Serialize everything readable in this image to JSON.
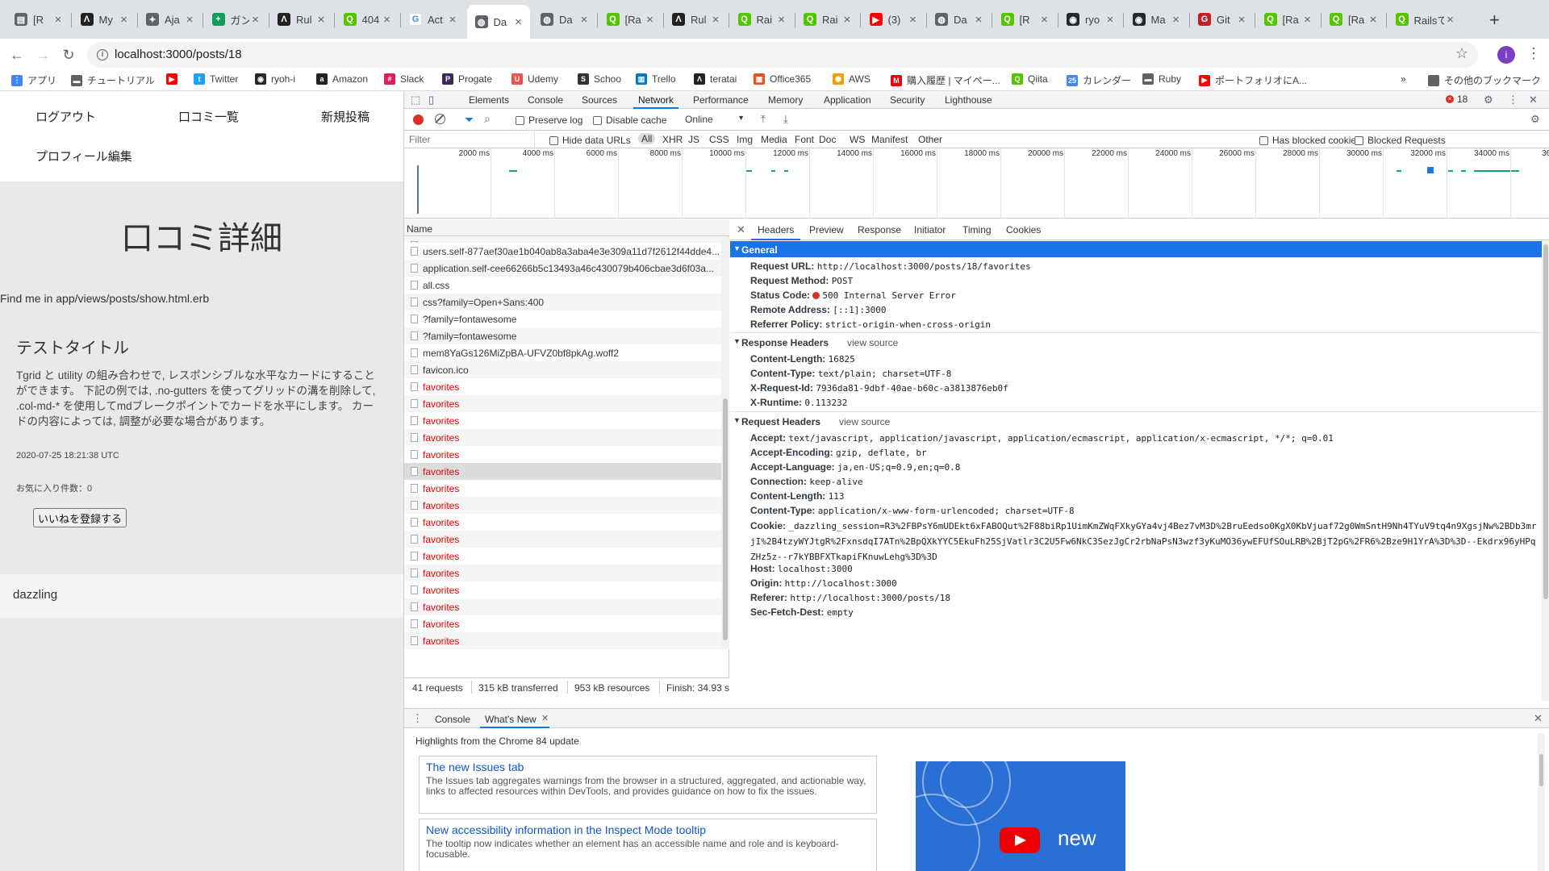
{
  "tabs": [
    {
      "title": "[R",
      "icon": "doc-icon",
      "color": "#5f6368",
      "glyph": "▤"
    },
    {
      "title": "My",
      "icon": "atcoder-icon",
      "color": "#222222",
      "glyph": "Λ"
    },
    {
      "title": "Aja",
      "icon": "puzzle-icon",
      "color": "#5f6368",
      "glyph": "✦"
    },
    {
      "title": "ガン",
      "icon": "sheets-icon",
      "color": "#0f9d58",
      "glyph": "+"
    },
    {
      "title": "Rul",
      "icon": "atcoder-icon",
      "color": "#222222",
      "glyph": "Λ"
    },
    {
      "title": "404",
      "icon": "qiita-icon",
      "color": "#55c500",
      "glyph": "Q"
    },
    {
      "title": "Act",
      "icon": "google-icon",
      "color": "#ffffff",
      "glyph": "G"
    },
    {
      "title": "Da",
      "icon": "globe-icon",
      "color": "#5f6368",
      "glyph": "◍"
    },
    {
      "title": "Da",
      "icon": "globe-icon",
      "color": "#5f6368",
      "glyph": "◍"
    },
    {
      "title": "[Ra",
      "icon": "qiita-icon",
      "color": "#55c500",
      "glyph": "Q"
    },
    {
      "title": "Rul",
      "icon": "atcoder-icon",
      "color": "#222222",
      "glyph": "Λ"
    },
    {
      "title": "Rai",
      "icon": "qiita-icon",
      "color": "#55c500",
      "glyph": "Q"
    },
    {
      "title": "Rai",
      "icon": "qiita-icon",
      "color": "#55c500",
      "glyph": "Q"
    },
    {
      "title": "(3)",
      "icon": "youtube-icon",
      "color": "#ff0000",
      "glyph": "▶"
    },
    {
      "title": "Da",
      "icon": "globe-icon",
      "color": "#5f6368",
      "glyph": "◍"
    },
    {
      "title": "[R",
      "icon": "qiita-icon",
      "color": "#55c500",
      "glyph": "Q"
    },
    {
      "title": "ryo",
      "icon": "github-icon",
      "color": "#24292e",
      "glyph": "◉"
    },
    {
      "title": "Ma",
      "icon": "github-icon",
      "color": "#24292e",
      "glyph": "◉"
    },
    {
      "title": "Git",
      "icon": "gitlab-red-icon",
      "color": "#c31f24",
      "glyph": "G"
    },
    {
      "title": "[Ra",
      "icon": "qiita-icon",
      "color": "#55c500",
      "glyph": "Q"
    },
    {
      "title": "[Ra",
      "icon": "qiita-icon",
      "color": "#55c500",
      "glyph": "Q"
    },
    {
      "title": "Railsで",
      "icon": "qiita-icon",
      "color": "#55c500",
      "glyph": "Q"
    }
  ],
  "address_bar": {
    "url": "localhost:3000/posts/18"
  },
  "profile_initial": "i",
  "bookmarks": [
    {
      "label": "アプリ",
      "icon": "apps-icon",
      "color": "#4285f4",
      "glyph": "⋮"
    },
    {
      "label": "チュートリアル",
      "icon": "folder-icon",
      "color": "#5f6368",
      "glyph": "▬"
    },
    {
      "label": "",
      "icon": "youtube-icon",
      "color": "#ff0000",
      "glyph": "▶"
    },
    {
      "label": "Twitter",
      "icon": "twitter-icon",
      "color": "#1da1f2",
      "glyph": "t"
    },
    {
      "label": "ryoh-i",
      "icon": "github-icon",
      "color": "#24292e",
      "glyph": "◉"
    },
    {
      "label": "Amazon",
      "icon": "amazon-icon",
      "color": "#222222",
      "glyph": "a"
    },
    {
      "label": "Slack",
      "icon": "slack-icon",
      "color": "#e01e5a",
      "glyph": "#"
    },
    {
      "label": "Progate",
      "icon": "progate-icon",
      "color": "#3d2a5a",
      "glyph": "P"
    },
    {
      "label": "Udemy",
      "icon": "udemy-icon",
      "color": "#ec5252",
      "glyph": "U"
    },
    {
      "label": "Schoo",
      "icon": "schoo-icon",
      "color": "#333333",
      "glyph": "S"
    },
    {
      "label": "Trello",
      "icon": "trello-icon",
      "color": "#0079bf",
      "glyph": "▥"
    },
    {
      "label": "teratai",
      "icon": "teratai-icon",
      "color": "#222222",
      "glyph": "Λ"
    },
    {
      "label": "Office365",
      "icon": "office-icon",
      "color": "#f25022",
      "glyph": "▦"
    },
    {
      "label": "AWS",
      "icon": "aws-icon",
      "color": "#ff9900",
      "glyph": "⬢"
    },
    {
      "label": "購入履歴 | マイペー...",
      "icon": "shop-icon",
      "color": "#e60012",
      "glyph": "M"
    },
    {
      "label": "Qiita",
      "icon": "qiita-icon",
      "color": "#55c500",
      "glyph": "Q"
    },
    {
      "label": "カレンダー",
      "icon": "calendar-icon",
      "color": "#4285f4",
      "glyph": "25"
    },
    {
      "label": "Ruby",
      "icon": "folder-icon",
      "color": "#5f6368",
      "glyph": "▬"
    },
    {
      "label": "ポートフォリオにA...",
      "icon": "youtube-icon",
      "color": "#ff0000",
      "glyph": "▶"
    }
  ],
  "bookmarks_more": "»",
  "other_bookmarks": "その他のブックマーク",
  "page": {
    "nav": {
      "logout": "ログアウト",
      "list": "口コミ一覧",
      "new_post": "新規投稿",
      "profile": "プロフィール編集"
    },
    "heading": "口コミ詳細",
    "find_me": "Find me in app/views/posts/show.html.erb",
    "card_title": "テストタイトル",
    "card_body": "Tgrid と utility の組み合わせで, レスポンシブルな水平なカードにすることができます。 下記の例では, .no-gutters を使ってグリッドの溝を削除して, .col-md-* を使用してmdブレークポイントでカードを水平にします。 カードの内容によっては, 調整が必要な場合があります。",
    "date": "2020-07-25 18:21:38 UTC",
    "favorites": "お気に入り件数：0",
    "like_button": "いいねを登録する",
    "footer": "dazzling"
  },
  "devtools": {
    "tabs": [
      "Elements",
      "Console",
      "Sources",
      "Network",
      "Performance",
      "Memory",
      "Application",
      "Security",
      "Lighthouse"
    ],
    "active_tab": "Network",
    "error_count": "18",
    "toolbar": {
      "preserve_log": "Preserve log",
      "disable_cache": "Disable cache",
      "throttling": "Online"
    },
    "filter": {
      "placeholder": "Filter",
      "hide_data_urls": "Hide data URLs",
      "types": [
        "All",
        "XHR",
        "JS",
        "CSS",
        "Img",
        "Media",
        "Font",
        "Doc",
        "WS",
        "Manifest",
        "Other"
      ],
      "has_blocked_cookies": "Has blocked cookies",
      "blocked_requests": "Blocked Requests"
    },
    "overview_ticks": [
      "2000 ms",
      "4000 ms",
      "6000 ms",
      "8000 ms",
      "10000 ms",
      "12000 ms",
      "14000 ms",
      "16000 ms",
      "18000 ms",
      "20000 ms",
      "22000 ms",
      "24000 ms",
      "26000 ms",
      "28000 ms",
      "30000 ms",
      "32000 ms",
      "34000 ms",
      "36000 m"
    ],
    "name_header": "Name",
    "requests": [
      {
        "name": "users.self-877aef30ae1b040ab8a3aba4e3e309a11d7f2612f44dde4...",
        "error": false
      },
      {
        "name": "application.self-cee66266b5c13493a46c430079b406cbae3d6f03a...",
        "error": false
      },
      {
        "name": "all.css",
        "error": false
      },
      {
        "name": "css?family=Open+Sans:400",
        "error": false
      },
      {
        "name": "?family=fontawesome",
        "error": false
      },
      {
        "name": "?family=fontawesome",
        "error": false
      },
      {
        "name": "mem8YaGs126MiZpBA-UFVZ0bf8pkAg.woff2",
        "error": false
      },
      {
        "name": "favicon.ico",
        "error": false
      },
      {
        "name": "favorites",
        "error": true
      },
      {
        "name": "favorites",
        "error": true
      },
      {
        "name": "favorites",
        "error": true
      },
      {
        "name": "favorites",
        "error": true
      },
      {
        "name": "favorites",
        "error": true
      },
      {
        "name": "favorites",
        "error": true,
        "selected": true
      },
      {
        "name": "favorites",
        "error": true
      },
      {
        "name": "favorites",
        "error": true
      },
      {
        "name": "favorites",
        "error": true
      },
      {
        "name": "favorites",
        "error": true
      },
      {
        "name": "favorites",
        "error": true
      },
      {
        "name": "favorites",
        "error": true
      },
      {
        "name": "favorites",
        "error": true
      },
      {
        "name": "favorites",
        "error": true
      },
      {
        "name": "favorites",
        "error": true
      },
      {
        "name": "favorites",
        "error": true
      },
      {
        "name": "favorites",
        "error": true
      },
      {
        "name": "favorites",
        "error": true
      }
    ],
    "status_bar": {
      "requests": "41 requests",
      "transferred": "315 kB transferred",
      "resources": "953 kB resources",
      "finish": "Finish: 34.93 s"
    },
    "detail_tabs": [
      "Headers",
      "Preview",
      "Response",
      "Initiator",
      "Timing",
      "Cookies"
    ],
    "general": {
      "title": "General",
      "rows": [
        {
          "k": "Request URL:",
          "v": "http://localhost:3000/posts/18/favorites"
        },
        {
          "k": "Request Method:",
          "v": "POST"
        },
        {
          "k": "Status Code:",
          "v": "500 Internal Server Error"
        },
        {
          "k": "Remote Address:",
          "v": "[::1]:3000"
        },
        {
          "k": "Referrer Policy:",
          "v": "strict-origin-when-cross-origin"
        }
      ]
    },
    "response_headers": {
      "title": "Response Headers",
      "view_source": "view source",
      "rows": [
        {
          "k": "Content-Length:",
          "v": "16825"
        },
        {
          "k": "Content-Type:",
          "v": "text/plain; charset=UTF-8"
        },
        {
          "k": "X-Request-Id:",
          "v": "7936da81-9dbf-40ae-b60c-a3813876eb0f"
        },
        {
          "k": "X-Runtime:",
          "v": "0.113232"
        }
      ]
    },
    "request_headers": {
      "title": "Request Headers",
      "view_source": "view source",
      "rows": [
        {
          "k": "Accept:",
          "v": "text/javascript, application/javascript, application/ecmascript, application/x-ecmascript, */*; q=0.01"
        },
        {
          "k": "Accept-Encoding:",
          "v": "gzip, deflate, br"
        },
        {
          "k": "Accept-Language:",
          "v": "ja,en-US;q=0.9,en;q=0.8"
        },
        {
          "k": "Connection:",
          "v": "keep-alive"
        },
        {
          "k": "Content-Length:",
          "v": "113"
        },
        {
          "k": "Content-Type:",
          "v": "application/x-www-form-urlencoded; charset=UTF-8"
        }
      ],
      "cookie_key": "Cookie:",
      "cookie_value": "_dazzling_session=R3%2FBPsY6mUDEkt6xFABOQut%2F88biRp1UimKmZWqFXkyGYa4vj4Bez7vM3D%2BruEedso0KgX0KbVjuaf72g0WmSntH9Nh4TYuV9tq4n9XgsjNw%2BDb3mrjI%2B4tzyWYJtgR%2FxnsdqI7ATn%2BpQXkYYC5EkuFh25SjVatlr3C2U5Fw6NkC3SezJgCr2rbNaPsN3wzf3yKuMO36ywEFUfSOuLRB%2BjT2pG%2FR6%2Bze9H1YrA%3D%3D--Ekdrx96yHPqZHz5z--r7kYBBFXTkapiFKnuwLehg%3D%3D",
      "rows2": [
        {
          "k": "Host:",
          "v": "localhost:3000"
        },
        {
          "k": "Origin:",
          "v": "http://localhost:3000"
        },
        {
          "k": "Referer:",
          "v": "http://localhost:3000/posts/18"
        },
        {
          "k": "Sec-Fetch-Dest:",
          "v": "empty"
        }
      ]
    },
    "drawer": {
      "tabs": [
        "Console",
        "What's New"
      ],
      "highlights": "Highlights from the Chrome 84 update",
      "items": [
        {
          "title": "The new Issues tab",
          "desc": "The Issues tab aggregates warnings from the browser in a structured, aggregated, and actionable way, links to affected resources within DevTools, and provides guidance on how to fix the issues."
        },
        {
          "title": "New accessibility information in the Inspect Mode tooltip",
          "desc": "The tooltip now indicates whether an element has an accessible name and role and is keyboard-focusable."
        }
      ],
      "video_text": "new"
    },
    "colors": {
      "accent": "#1a73e8",
      "error": "#e00000",
      "record": "#d93025"
    }
  }
}
